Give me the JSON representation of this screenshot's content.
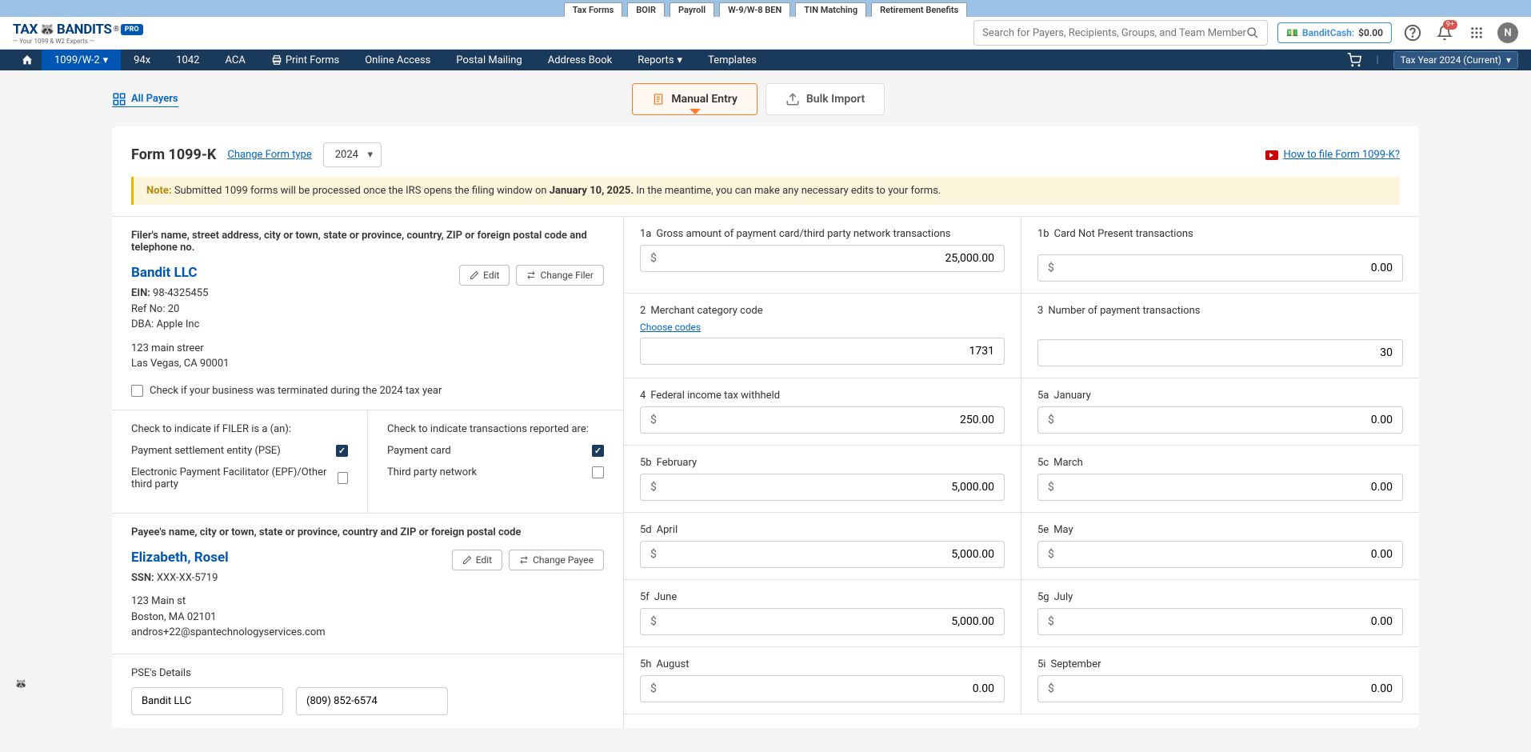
{
  "top_tabs": [
    "Tax Forms",
    "BOIR",
    "Payroll",
    "W-9/W-8 BEN",
    "TIN Matching",
    "Retirement Benefits"
  ],
  "active_top_tab": 0,
  "logo": {
    "main": "TAX",
    "rest": "BANDITS",
    "sub": "— Your 1099 & W2 Experts —",
    "badge": "PRO"
  },
  "search": {
    "placeholder": "Search for Payers, Recipients, Groups, and Team Members"
  },
  "bandit_cash": {
    "label": "BanditCash:",
    "amount": "$0.00"
  },
  "notif_badge": "9+",
  "avatar_initial": "N",
  "nav": {
    "items": [
      "1099/W-2",
      "94x",
      "1042",
      "ACA",
      "Print Forms",
      "Online Access",
      "Postal Mailing",
      "Address Book",
      "Reports",
      "Templates"
    ],
    "tax_year": "Tax Year 2024 (Current)"
  },
  "all_payers": "All Payers",
  "entry_tabs": {
    "manual": "Manual Entry",
    "bulk": "Bulk Import"
  },
  "form": {
    "title": "Form 1099-K",
    "change_type": "Change Form type",
    "year": "2024",
    "how_to": "How to file Form 1099-K?"
  },
  "note": {
    "prefix": "Note:",
    "text1": " Submitted 1099 forms will be processed once the IRS opens the filing window on ",
    "date": "January 10, 2025.",
    "text2": " In the meantime, you can make any necessary edits to your forms."
  },
  "filer": {
    "section_title": "Filer's name, street address, city or town, state or province, country, ZIP or foreign postal code and telephone no.",
    "name": "Bandit LLC",
    "ein_label": "EIN:",
    "ein": "98-4325455",
    "ref_label": "Ref No:",
    "ref": "20",
    "dba_label": "DBA:",
    "dba": "Apple Inc",
    "addr1": "123 main streer",
    "addr2": "Las Vegas, CA 90001",
    "edit": "Edit",
    "change": "Change Filer",
    "terminate": "Check if your business was terminated during the 2024 tax year"
  },
  "indicate": {
    "filer_title": "Check to indicate if FILER is a (an):",
    "pse": "Payment settlement entity (PSE)",
    "epf": "Electronic Payment Facilitator (EPF)/Other third party",
    "trans_title": "Check to indicate transactions reported are:",
    "pc": "Payment card",
    "tpn": "Third party network"
  },
  "payee": {
    "section_title": "Payee's name, city or town, state or province, country and ZIP or foreign postal code",
    "name": "Elizabeth, Rosel",
    "ssn_label": "SSN:",
    "ssn": "XXX-XX-5719",
    "addr1": "123 Main st",
    "addr2": "Boston, MA 02101",
    "email": "andros+22@spantechnologyservices.com",
    "edit": "Edit",
    "change": "Change Payee"
  },
  "pse": {
    "title": "PSE's Details",
    "name": "Bandit LLC",
    "phone": "(809) 852-6574"
  },
  "boxes": {
    "1a": {
      "label": "Gross amount of payment card/third party network transactions",
      "value": "25,000.00"
    },
    "1b": {
      "label": "Card Not Present transactions",
      "value": "0.00"
    },
    "2": {
      "label": "Merchant category code",
      "choose": "Choose codes",
      "value": "1731"
    },
    "3": {
      "label": "Number of payment transactions",
      "value": "30"
    },
    "4": {
      "label": "Federal income tax withheld",
      "value": "250.00"
    },
    "5a": {
      "label": "January",
      "value": "0.00"
    },
    "5b": {
      "label": "February",
      "value": "5,000.00"
    },
    "5c": {
      "label": "March",
      "value": "0.00"
    },
    "5d": {
      "label": "April",
      "value": "5,000.00"
    },
    "5e": {
      "label": "May",
      "value": "0.00"
    },
    "5f": {
      "label": "June",
      "value": "5,000.00"
    },
    "5g": {
      "label": "July",
      "value": "0.00"
    },
    "5h": {
      "label": "August",
      "value": "0.00"
    },
    "5i": {
      "label": "September",
      "value": "0.00"
    }
  }
}
